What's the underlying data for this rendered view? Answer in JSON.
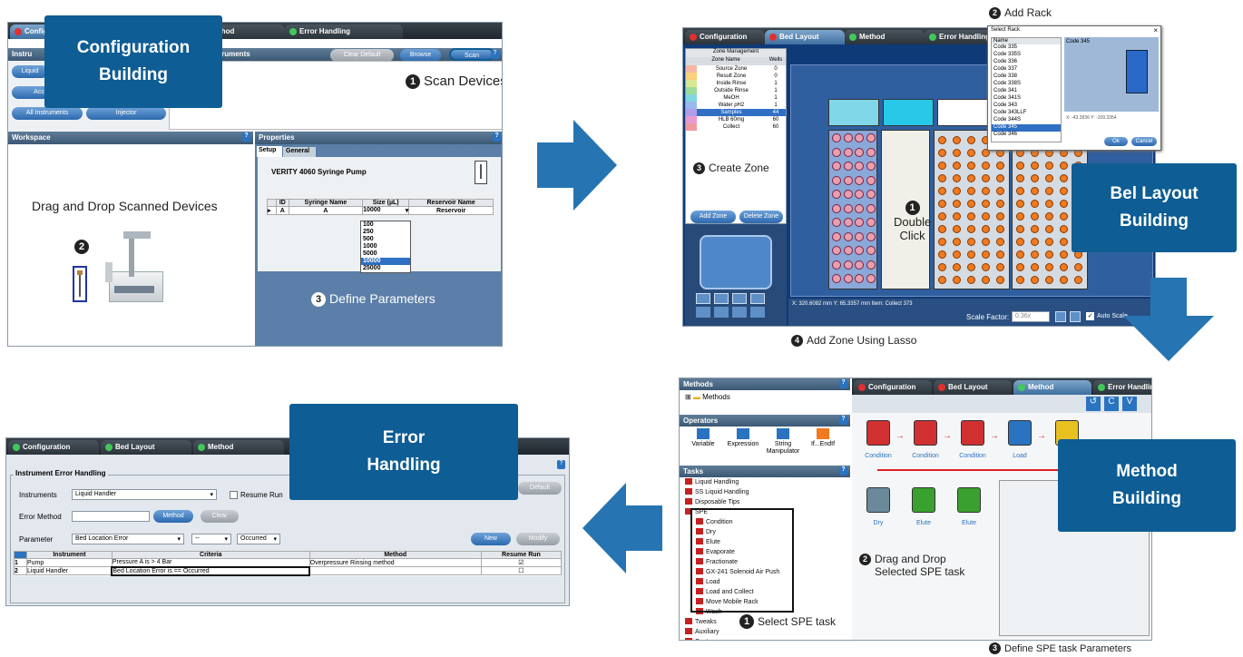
{
  "config": {
    "tabs": [
      "Configuration",
      "Method",
      "Error Handling"
    ],
    "instruments_label": "Instru",
    "instruments_header": "struments",
    "left_buttons": [
      "Liquid",
      "Acc",
      "All Instruments",
      "Injector"
    ],
    "clear_default": "Clear Default",
    "browse": "Browse",
    "scan": "Scan",
    "scan_note": "Scan Devices",
    "workspace": "Workspace",
    "properties": "Properties",
    "subtabs": [
      "Setup",
      "General"
    ],
    "device_title": "VERITY 4060 Syringe Pump",
    "table_headers": [
      "ID",
      "Syringe Name",
      "Size (µL)",
      "Reservoir Name"
    ],
    "table_row": [
      "A",
      "A",
      "10000",
      "Reservoir"
    ],
    "size_options": [
      "100",
      "250",
      "500",
      "1000",
      "5000",
      "10000",
      "25000"
    ],
    "drag_note": "Drag and Drop Scanned Devices",
    "define_note": "Define Parameters",
    "callout": [
      "Configuration",
      "Building"
    ]
  },
  "bed": {
    "tabs": [
      "Configuration",
      "Bed Layout",
      "Method",
      "Error Handling"
    ],
    "zone_mgmt": "Zone Management",
    "zone_cols": [
      "Zone Name",
      "Wells"
    ],
    "zones": [
      {
        "name": "Source Zone",
        "wells": "0",
        "color": "#f7b7a3"
      },
      {
        "name": "Result Zone",
        "wells": "0",
        "color": "#fad07a"
      },
      {
        "name": "Inside Rinse",
        "wells": "1",
        "color": "#d8e890"
      },
      {
        "name": "Outside Rinse",
        "wells": "1",
        "color": "#9ddc9a"
      },
      {
        "name": "MeOH",
        "wells": "1",
        "color": "#7fd7e0"
      },
      {
        "name": "Water pH2",
        "wells": "1",
        "color": "#9ab8f0"
      },
      {
        "name": "Samples",
        "wells": "44",
        "color": "#b29de8"
      },
      {
        "name": "HLB 60mg",
        "wells": "60",
        "color": "#e89ad0"
      },
      {
        "name": "Collect",
        "wells": "60",
        "color": "#f09aa0"
      }
    ],
    "create_zone": "Create Zone",
    "add_zone": "Add Zone",
    "delete_zone": "Delete Zone",
    "double_click": [
      "Double",
      "Click"
    ],
    "status": "X: 320.6082 mm  Y: 65.3357 mm   Item: Collect 373",
    "scale_label": "Scale Factor:",
    "scale_value": "0.36x",
    "auto_scale": "Auto Scale",
    "add_rack_note": "Add Rack",
    "lasso_note": "Add Zone Using Lasso",
    "callout": [
      "Bel Layout",
      "Building"
    ],
    "rack_dialog": {
      "title": "Select Rack",
      "col": "Name",
      "preview_title": "Code 345",
      "items": [
        "Code 335",
        "Code 335S",
        "Code 336",
        "Code 337",
        "Code 338",
        "Code 338S",
        "Code 341",
        "Code 341S",
        "Code 343",
        "Code 343LLF",
        "Code 344S",
        "Code 345",
        "Code 346"
      ],
      "selected": "Code 345",
      "coords": "X: -43.3936   Y: -109.3354",
      "ok": "Ok",
      "cancel": "Cancel"
    }
  },
  "method": {
    "methods_hdr": "Methods",
    "methods_folder": "Methods",
    "operators_hdr": "Operators",
    "operators": [
      "Variable",
      "Expression",
      "String Manipulator",
      "If...EndIf"
    ],
    "tasks_hdr": "Tasks",
    "tasks_top": [
      "Liquid Handling",
      "SS Liquid Handling",
      "Disposable Tips",
      "SPE"
    ],
    "spe_items": [
      "Condition",
      "Dry",
      "Elute",
      "Evaporate",
      "Fractionate",
      "GX-241 Solenoid Air Push",
      "Load",
      "Load and Collect",
      "Move Mobile Rack",
      "Wash"
    ],
    "tasks_bottom": [
      "Tweaks",
      "Auxiliary",
      "Custom",
      "Utility Tasks"
    ],
    "tabs": [
      "Configuration",
      "Bed Layout",
      "Method",
      "Error Handling"
    ],
    "flow1": [
      "Condition",
      "Condition",
      "Condition",
      "Load",
      "W"
    ],
    "flow2": [
      "Dry",
      "Elute",
      "Elute"
    ],
    "select_note": "Select SPE task",
    "drag_note": [
      "Drag and Drop",
      "Selected SPE task"
    ],
    "define_note": "Define SPE task Parameters",
    "callout": [
      "Method",
      "Building"
    ]
  },
  "error": {
    "tabs": [
      "Configuration",
      "Bed Layout",
      "Method"
    ],
    "group": "Instrument Error Handling",
    "instruments_label": "Instruments",
    "instruments_value": "Liquid Handler",
    "resume_run": "Resume Run",
    "error_method_label": "Error Method",
    "method_btn": "Method",
    "clear_btn": "Clear",
    "parameter_label": "Parameter",
    "parameter_value": "Bed Location Error",
    "op_value": "--",
    "occ_value": "Occurred",
    "new_btn": "New",
    "modify_btn": "Modify",
    "default_btn": "Default",
    "table_headers": [
      "Instrument",
      "Criteria",
      "Method",
      "Resume Run"
    ],
    "rows": [
      [
        "1",
        "Pump",
        "Pressure A is > 4 Bar",
        "Overpressure Rinsing method"
      ],
      [
        "2",
        "Liquid Handler",
        "Bed Location Error is == Occurred",
        ""
      ]
    ],
    "callout": [
      "Error",
      "Handling"
    ]
  },
  "colors": {
    "accent": "#0e5d94",
    "arrow": "#2675b2"
  }
}
